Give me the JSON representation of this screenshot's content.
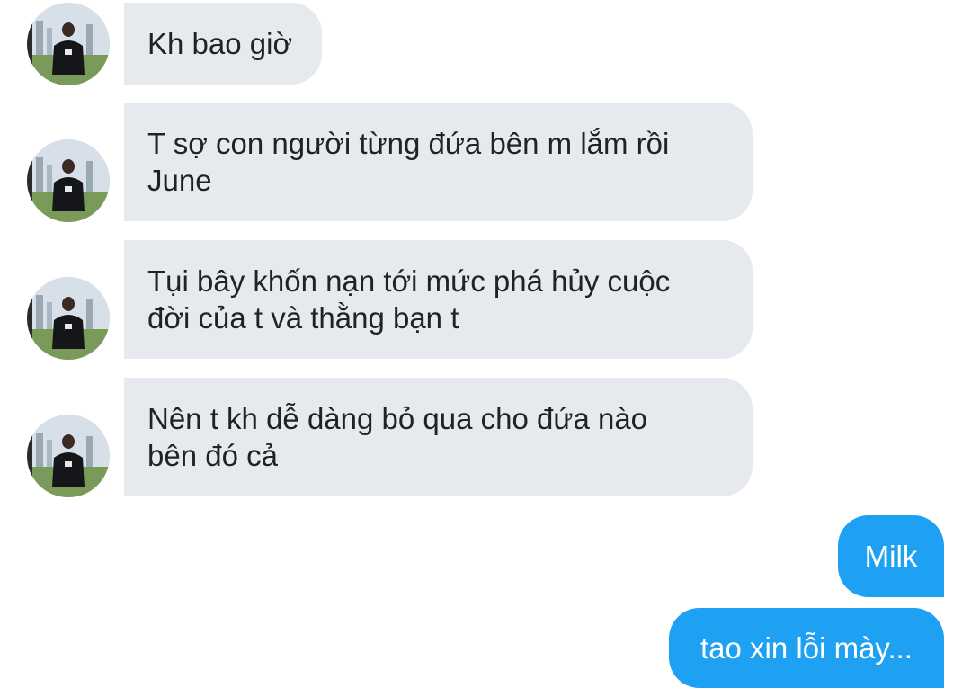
{
  "conversation": {
    "incoming": [
      {
        "text": "Kh bao giờ"
      },
      {
        "text": "T sợ con người từng đứa bên m lắm rồi\nJune"
      },
      {
        "text": "Tụi bây khốn nạn tới mức phá hủy cuộc\nđời của t và thằng bạn t"
      },
      {
        "text": "Nên t kh dễ dàng bỏ qua cho đứa nào\nbên đó cả"
      }
    ],
    "outgoing": [
      {
        "text": "Milk"
      },
      {
        "text": "tao xin lỗi mày..."
      }
    ]
  },
  "colors": {
    "incoming_bubble": "#e6eaee",
    "outgoing_bubble": "#1ea1f2",
    "text_dark": "#1f2328"
  }
}
